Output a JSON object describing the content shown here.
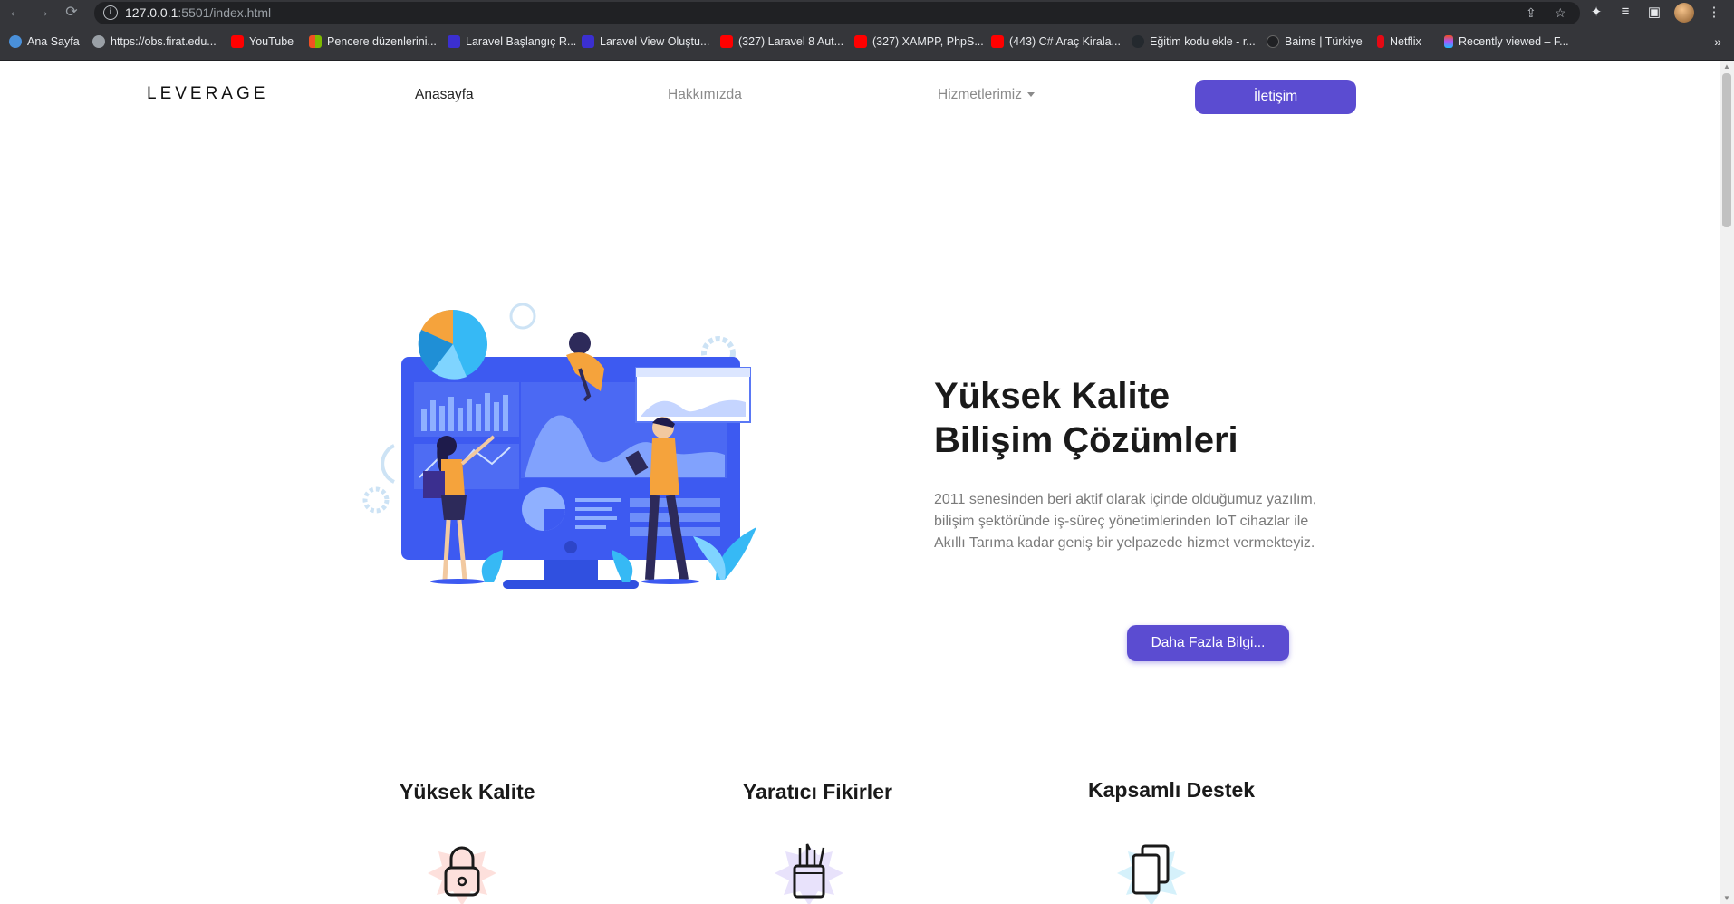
{
  "browser": {
    "url_host": "127.0.0.1",
    "url_rest": ":5501/index.html",
    "bookmarks": [
      {
        "label": "Ana Sayfa",
        "color": "#4a90d9"
      },
      {
        "label": "https://obs.firat.edu...",
        "color": "#9aa0a6"
      },
      {
        "label": "YouTube",
        "color": "#ff0000"
      },
      {
        "label": "Pencere düzenlerini...",
        "color": "#f25022"
      },
      {
        "label": "Laravel Başlangıç R...",
        "color": "#3b2fd0"
      },
      {
        "label": "Laravel View Oluştu...",
        "color": "#3b2fd0"
      },
      {
        "label": "(327) Laravel 8 Aut...",
        "color": "#ff0000"
      },
      {
        "label": "(327) XAMPP, PhpS...",
        "color": "#ff0000"
      },
      {
        "label": "(443) C# Araç Kirala...",
        "color": "#ff0000"
      },
      {
        "label": "Eğitim kodu ekle - r...",
        "color": "#24292e"
      },
      {
        "label": "Baims | Türkiye",
        "color": "#202124"
      },
      {
        "label": "Netflix",
        "color": "#e50914"
      },
      {
        "label": "Recently viewed – F...",
        "color": "#a259ff"
      }
    ],
    "more_label": "»"
  },
  "nav": {
    "logo": "LEVERAGE",
    "items": [
      {
        "label": "Anasayfa"
      },
      {
        "label": "Hakkımızda"
      },
      {
        "label": "Hizmetlerimiz"
      }
    ],
    "contact": "İletişim"
  },
  "hero": {
    "title_line1": "Yüksek Kalite",
    "title_line2": "Bilişim Çözümleri",
    "text": "2011 senesinden beri aktif olarak içinde olduğumuz yazılım, bilişim şektöründe iş-süreç yönetimlerinden IoT cihazlar ile Akıllı Tarıma kadar geniş bir yelpazede hizmet vermekteyiz.",
    "button": "Daha Fazla Bilgi..."
  },
  "features": [
    {
      "title": "Yüksek Kalite",
      "icon": "lock-icon"
    },
    {
      "title": "Yaratıcı Fikirler",
      "icon": "pen-holder-icon"
    },
    {
      "title": "Kapsamlı Destek",
      "icon": "copy-icon"
    }
  ],
  "colors": {
    "accent": "#5b4cd1",
    "illustration_blue": "#3d5af1"
  }
}
